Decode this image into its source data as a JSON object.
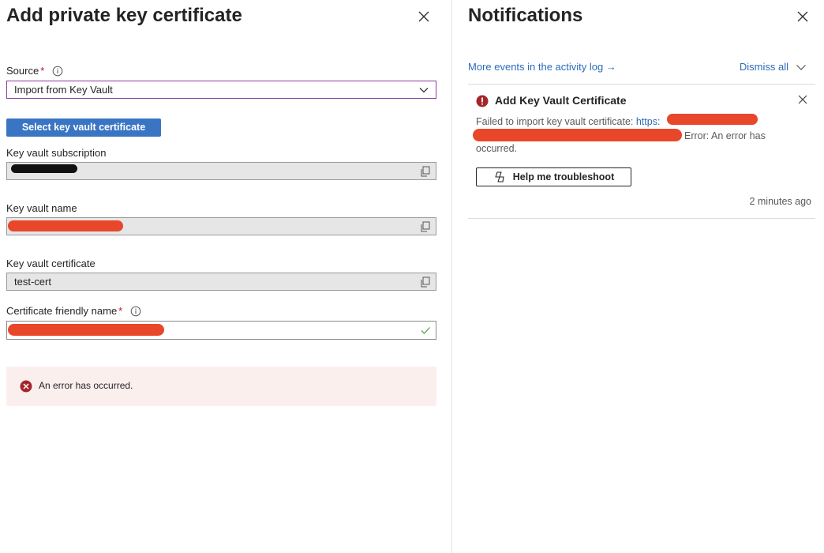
{
  "add_panel": {
    "title": "Add private key certificate",
    "source_label": "Source",
    "required_mark": "*",
    "source_value": "Import from Key Vault",
    "select_button": "Select key vault certificate",
    "subscription_label": "Key vault subscription",
    "vault_name_label": "Key vault name",
    "certificate_label": "Key vault certificate",
    "certificate_value": "test-cert",
    "friendly_name_label": "Certificate friendly name",
    "error_message": "An error has occurred."
  },
  "notifications": {
    "title": "Notifications",
    "activity_link": "More events in the activity log →",
    "dismiss_all": "Dismiss all",
    "item": {
      "title": "Add Key Vault Certificate",
      "message_prefix": "Failed to import key vault certificate: ",
      "url_fragment": "https:",
      "message_tail": "Error: An error has",
      "message_end": "occurred.",
      "help_button": "Help me troubleshoot",
      "time": "2 minutes ago"
    }
  },
  "colors": {
    "primary_button": "#3a75c4",
    "link": "#2b6cb9",
    "error": "#a4262c",
    "required": "#c50f1f",
    "redaction_red": "#e8472a",
    "redaction_black": "#111111",
    "select_border": "#8a3d9e"
  },
  "icons": {
    "close": "close-icon",
    "info": "info-icon",
    "chevron": "chevron-down-icon",
    "copy": "copy-icon",
    "check": "checkmark-icon",
    "error": "error-circle-icon",
    "alert": "alert-circle-icon",
    "copilot": "copilot-icon"
  }
}
